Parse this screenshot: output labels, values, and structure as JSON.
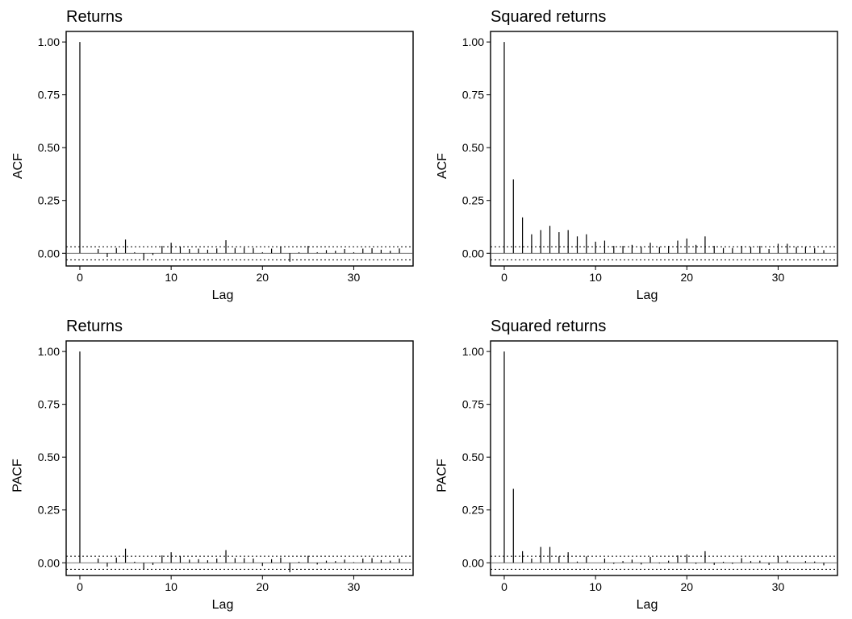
{
  "layout": {
    "rows": 2,
    "cols": 2
  },
  "panels": [
    {
      "id": "p0",
      "title": "Returns",
      "ylabel": "ACF",
      "xlabel": "Lag",
      "chart_ref": 0
    },
    {
      "id": "p1",
      "title": "Squared returns",
      "ylabel": "ACF",
      "xlabel": "Lag",
      "chart_ref": 1
    },
    {
      "id": "p2",
      "title": "Returns",
      "ylabel": "PACF",
      "xlabel": "Lag",
      "chart_ref": 2
    },
    {
      "id": "p3",
      "title": "Squared returns",
      "ylabel": "PACF",
      "xlabel": "Lag",
      "chart_ref": 3
    }
  ],
  "chart_data": [
    {
      "type": "bar",
      "title": "Returns",
      "xlabel": "Lag",
      "ylabel": "ACF",
      "xlim": [
        -1.5,
        36.5
      ],
      "ylim": [
        -0.06,
        1.05
      ],
      "xticks": [
        0,
        10,
        20,
        30
      ],
      "yticks": [
        0.0,
        0.25,
        0.5,
        0.75,
        1.0
      ],
      "ytick_labels": [
        "0.00",
        "0.25",
        "0.50",
        "0.75",
        "1.00"
      ],
      "ci": 0.031,
      "x": [
        0,
        1,
        2,
        3,
        4,
        5,
        6,
        7,
        8,
        9,
        10,
        11,
        12,
        13,
        14,
        15,
        16,
        17,
        18,
        19,
        20,
        21,
        22,
        23,
        24,
        25,
        26,
        27,
        28,
        29,
        30,
        31,
        32,
        33,
        34,
        35
      ],
      "values": [
        1.0,
        0.0,
        0.02,
        -0.018,
        0.025,
        0.065,
        0.005,
        -0.028,
        -0.008,
        0.035,
        0.05,
        0.032,
        0.02,
        0.022,
        0.017,
        0.023,
        0.062,
        0.025,
        0.027,
        0.025,
        0.005,
        0.022,
        0.03,
        -0.04,
        0.005,
        0.035,
        0.005,
        0.015,
        0.012,
        0.02,
        0.005,
        0.022,
        0.024,
        0.017,
        0.012,
        0.023
      ]
    },
    {
      "type": "bar",
      "title": "Squared returns",
      "xlabel": "Lag",
      "ylabel": "ACF",
      "xlim": [
        -1.5,
        36.5
      ],
      "ylim": [
        -0.06,
        1.05
      ],
      "xticks": [
        0,
        10,
        20,
        30
      ],
      "yticks": [
        0.0,
        0.25,
        0.5,
        0.75,
        1.0
      ],
      "ytick_labels": [
        "0.00",
        "0.25",
        "0.50",
        "0.75",
        "1.00"
      ],
      "ci": 0.031,
      "x": [
        0,
        1,
        2,
        3,
        4,
        5,
        6,
        7,
        8,
        9,
        10,
        11,
        12,
        13,
        14,
        15,
        16,
        17,
        18,
        19,
        20,
        21,
        22,
        23,
        24,
        25,
        26,
        27,
        28,
        29,
        30,
        31,
        32,
        33,
        34,
        35
      ],
      "values": [
        1.0,
        0.35,
        0.17,
        0.09,
        0.11,
        0.13,
        0.1,
        0.11,
        0.08,
        0.09,
        0.055,
        0.06,
        0.035,
        0.035,
        0.04,
        0.03,
        0.05,
        0.03,
        0.035,
        0.06,
        0.07,
        0.04,
        0.08,
        0.035,
        0.025,
        0.025,
        0.035,
        0.03,
        0.035,
        0.02,
        0.045,
        0.045,
        0.03,
        0.03,
        0.025,
        0.015
      ]
    },
    {
      "type": "bar",
      "title": "Returns",
      "xlabel": "Lag",
      "ylabel": "PACF",
      "xlim": [
        -1.5,
        36.5
      ],
      "ylim": [
        -0.06,
        1.05
      ],
      "xticks": [
        0,
        10,
        20,
        30
      ],
      "yticks": [
        0.0,
        0.25,
        0.5,
        0.75,
        1.0
      ],
      "ytick_labels": [
        "0.00",
        "0.25",
        "0.50",
        "0.75",
        "1.00"
      ],
      "ci": 0.031,
      "x": [
        0,
        1,
        2,
        3,
        4,
        5,
        6,
        7,
        8,
        9,
        10,
        11,
        12,
        13,
        14,
        15,
        16,
        17,
        18,
        19,
        20,
        21,
        22,
        23,
        24,
        25,
        26,
        27,
        28,
        29,
        30,
        31,
        32,
        33,
        34,
        35
      ],
      "values": [
        1.0,
        0.0,
        0.02,
        -0.018,
        0.025,
        0.067,
        0.005,
        -0.03,
        -0.01,
        0.035,
        0.05,
        0.031,
        0.015,
        0.017,
        0.012,
        0.02,
        0.06,
        0.022,
        0.022,
        0.02,
        -0.015,
        0.017,
        0.025,
        -0.045,
        0.005,
        0.033,
        -0.008,
        0.01,
        0.008,
        0.015,
        0.003,
        0.02,
        0.022,
        0.013,
        0.01,
        0.02
      ]
    },
    {
      "type": "bar",
      "title": "Squared returns",
      "xlabel": "Lag",
      "ylabel": "PACF",
      "xlim": [
        -1.5,
        36.5
      ],
      "ylim": [
        -0.06,
        1.05
      ],
      "xticks": [
        0,
        10,
        20,
        30
      ],
      "yticks": [
        0.0,
        0.25,
        0.5,
        0.75,
        1.0
      ],
      "ytick_labels": [
        "0.00",
        "0.25",
        "0.50",
        "0.75",
        "1.00"
      ],
      "ci": 0.031,
      "x": [
        0,
        1,
        2,
        3,
        4,
        5,
        6,
        7,
        8,
        9,
        10,
        11,
        12,
        13,
        14,
        15,
        16,
        17,
        18,
        19,
        20,
        21,
        22,
        23,
        24,
        25,
        26,
        27,
        28,
        29,
        30,
        31,
        32,
        33,
        34,
        35
      ],
      "values": [
        1.0,
        0.35,
        0.055,
        0.02,
        0.075,
        0.075,
        0.03,
        0.05,
        0.006,
        0.03,
        0.0,
        0.02,
        -0.005,
        0.008,
        0.015,
        -0.008,
        0.028,
        -0.003,
        0.01,
        0.035,
        0.04,
        -0.005,
        0.055,
        -0.01,
        0.005,
        -0.005,
        0.022,
        0.008,
        0.01,
        -0.01,
        0.03,
        0.01,
        0.0,
        0.008,
        0.006,
        -0.012
      ]
    }
  ]
}
